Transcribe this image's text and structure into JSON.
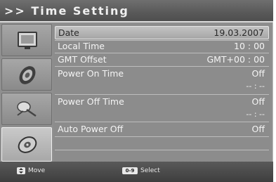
{
  "header": {
    "title": ">> Time Setting"
  },
  "sidebar": {
    "items": [
      {
        "icon": "tv-screen-icon",
        "active": false
      },
      {
        "icon": "speaker-icon",
        "active": false
      },
      {
        "icon": "satellite-dish-icon",
        "active": false
      },
      {
        "icon": "disc-settings-icon",
        "active": true
      }
    ]
  },
  "settings": [
    {
      "label": "Date",
      "value": "19.03.2007",
      "highlighted": true
    },
    {
      "label": "Local Time",
      "value": "10 : 00"
    },
    {
      "label": "GMT Offset",
      "value": "GMT+00 : 00"
    },
    {
      "label": "Power On Time",
      "value": "Off",
      "sub_value": "-- : --"
    },
    {
      "label": "Power Off Time",
      "value": "Off",
      "sub_value": "-- : --"
    },
    {
      "label": "Auto Power Off",
      "value": "Off"
    }
  ],
  "footer": {
    "move_label": "Move",
    "select_key": "0-9",
    "select_label": "Select"
  }
}
